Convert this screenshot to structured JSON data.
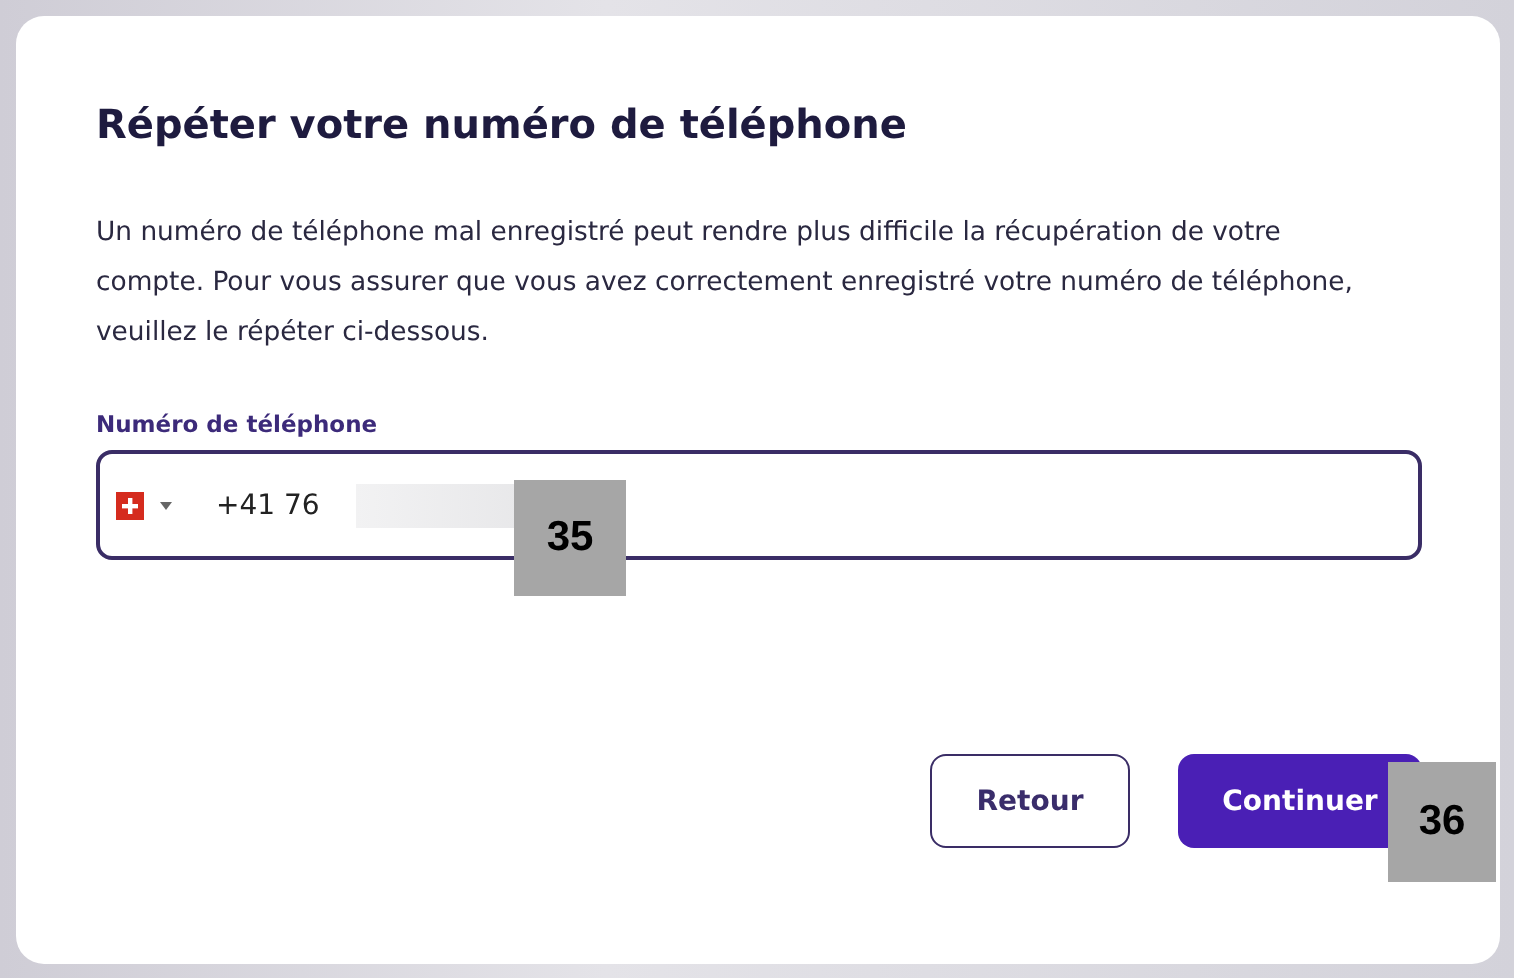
{
  "dialog": {
    "title": "Répéter votre numéro de téléphone",
    "description": "Un numéro de téléphone mal enregistré peut rendre plus difficile la récupération de votre compte. Pour vous assurer que vous avez correctement enregistré votre numéro de téléphone, veuillez le répéter ci-dessous.",
    "phone_field": {
      "label": "Numéro de téléphone",
      "value": "+41 76"
    },
    "buttons": [
      {
        "label": "Retour",
        "kind": "secondary"
      },
      {
        "label": "Continuer",
        "kind": "primary"
      }
    ]
  },
  "markers": [
    {
      "label": "35"
    },
    {
      "label": "36"
    }
  ]
}
